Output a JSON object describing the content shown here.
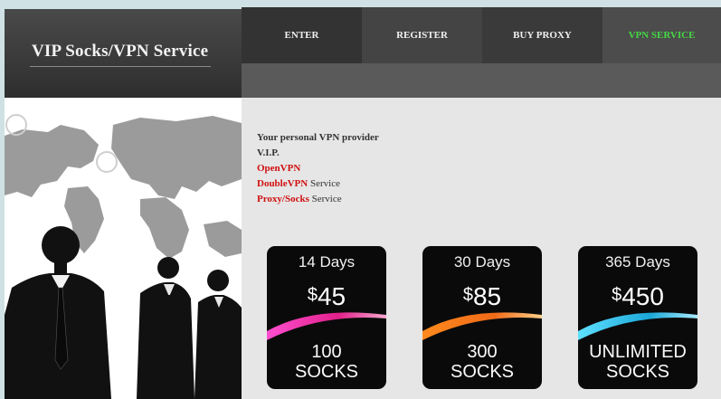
{
  "brand": {
    "title": "VIP Socks/VPN Service"
  },
  "nav": [
    {
      "label": "ENTER",
      "active": false
    },
    {
      "label": "REGISTER",
      "active": false
    },
    {
      "label": "BUY PROXY",
      "active": false
    },
    {
      "label": "VPN SERVICE",
      "active": true
    }
  ],
  "colors": {
    "active_nav": "#45d845",
    "highlight": "#d01010",
    "card_bg": "#0a0a0a"
  },
  "intro": {
    "line1": "Your personal VPN provider",
    "line2": "V.I.P.",
    "line3": "OpenVPN",
    "line4_highlight": "DoubleVPN",
    "line4_rest": " Service",
    "line5_highlight": "Proxy/Socks",
    "line5_rest": " Service"
  },
  "plans": [
    {
      "period": "14 Days",
      "currency": "$",
      "price": "45",
      "qty_line1": "100",
      "qty_line2": "SOCKS",
      "wave": "magenta"
    },
    {
      "period": "30 Days",
      "currency": "$",
      "price": "85",
      "qty_line1": "300",
      "qty_line2": "SOCKS",
      "wave": "orange"
    },
    {
      "period": "365 Days",
      "currency": "$",
      "price": "450",
      "qty_line1": "UNLIMITED",
      "qty_line2": "SOCKS",
      "wave": "cyan"
    }
  ]
}
